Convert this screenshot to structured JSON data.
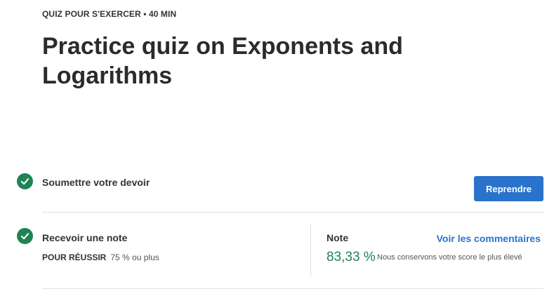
{
  "header": {
    "meta": "QUIZ POUR S'EXERCER • 40 MIN",
    "title": "Practice quiz on Exponents and Logarithms"
  },
  "steps": {
    "submit": {
      "label": "Soumettre votre devoir",
      "button": "Reprendre"
    },
    "grade": {
      "label": "Recevoir une note",
      "pass_key": "POUR RÉUSSIR",
      "pass_value": "75 % ou plus",
      "grade_title": "Note",
      "feedback_link": "Voir les commentaires",
      "grade_value": "83,33 %",
      "grade_note": "Nous conservons votre score le plus élevé"
    }
  },
  "colors": {
    "accent": "#2a73cc",
    "success": "#1f8354"
  },
  "icons": {
    "step_done": "check-circle-icon"
  }
}
